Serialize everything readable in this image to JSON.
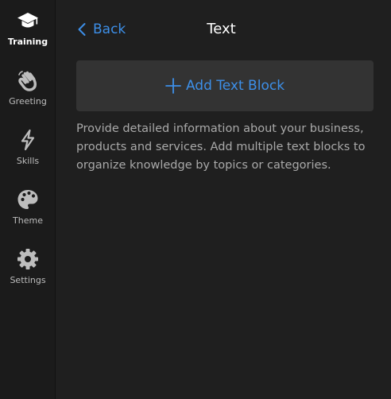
{
  "sidebar": {
    "items": [
      {
        "label": "Training",
        "icon": "graduation-cap-icon",
        "active": true
      },
      {
        "label": "Greeting",
        "icon": "waving-hand-icon",
        "active": false
      },
      {
        "label": "Skills",
        "icon": "lightning-bolt-icon",
        "active": false
      },
      {
        "label": "Theme",
        "icon": "palette-icon",
        "active": false
      },
      {
        "label": "Settings",
        "icon": "gear-icon",
        "active": false
      }
    ]
  },
  "header": {
    "back_label": "Back",
    "title": "Text"
  },
  "main": {
    "add_button_label": "Add Text Block",
    "description": "Provide detailed information about your business, products and services. Add multiple text blocks to organize knowledge by topics or categories."
  },
  "colors": {
    "accent": "#3d8fe8",
    "background": "#1f1f1f",
    "sidebar_background": "#1b1b1b",
    "card_background": "#333333",
    "muted_text": "#a9a9a9"
  }
}
